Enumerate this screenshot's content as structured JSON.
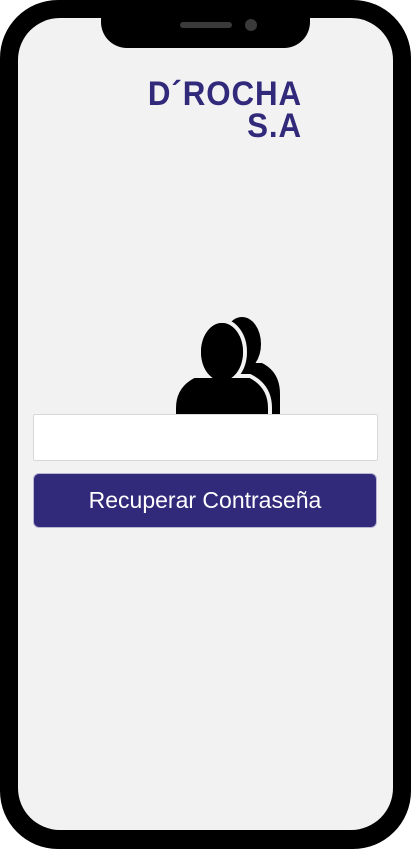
{
  "app": {
    "brand_line_1": "D´ROCHA",
    "brand_line_2": "S.A"
  },
  "form": {
    "email_value": "",
    "email_placeholder": "",
    "recover_button_label": "Recuperar Contraseña"
  },
  "icons": {
    "user": "users-icon"
  },
  "colors": {
    "accent": "#31297a",
    "background": "#f2f2f2",
    "frame": "#000000"
  }
}
